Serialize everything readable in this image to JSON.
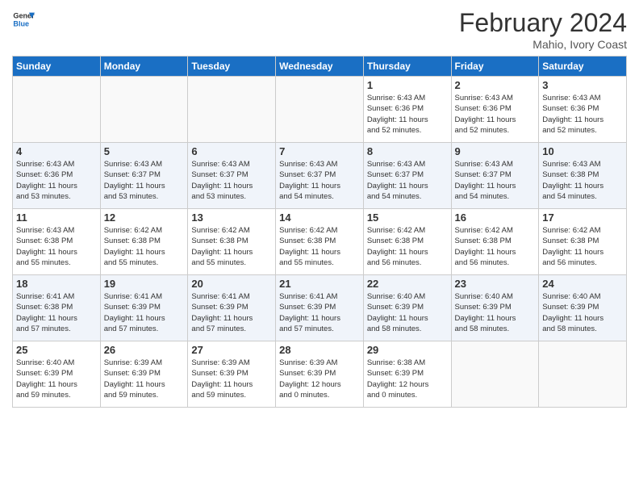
{
  "header": {
    "logo_line1": "General",
    "logo_line2": "Blue",
    "month": "February 2024",
    "location": "Mahio, Ivory Coast"
  },
  "days_of_week": [
    "Sunday",
    "Monday",
    "Tuesday",
    "Wednesday",
    "Thursday",
    "Friday",
    "Saturday"
  ],
  "weeks": [
    [
      {
        "day": "",
        "info": ""
      },
      {
        "day": "",
        "info": ""
      },
      {
        "day": "",
        "info": ""
      },
      {
        "day": "",
        "info": ""
      },
      {
        "day": "1",
        "info": "Sunrise: 6:43 AM\nSunset: 6:36 PM\nDaylight: 11 hours\nand 52 minutes."
      },
      {
        "day": "2",
        "info": "Sunrise: 6:43 AM\nSunset: 6:36 PM\nDaylight: 11 hours\nand 52 minutes."
      },
      {
        "day": "3",
        "info": "Sunrise: 6:43 AM\nSunset: 6:36 PM\nDaylight: 11 hours\nand 52 minutes."
      }
    ],
    [
      {
        "day": "4",
        "info": "Sunrise: 6:43 AM\nSunset: 6:36 PM\nDaylight: 11 hours\nand 53 minutes."
      },
      {
        "day": "5",
        "info": "Sunrise: 6:43 AM\nSunset: 6:37 PM\nDaylight: 11 hours\nand 53 minutes."
      },
      {
        "day": "6",
        "info": "Sunrise: 6:43 AM\nSunset: 6:37 PM\nDaylight: 11 hours\nand 53 minutes."
      },
      {
        "day": "7",
        "info": "Sunrise: 6:43 AM\nSunset: 6:37 PM\nDaylight: 11 hours\nand 54 minutes."
      },
      {
        "day": "8",
        "info": "Sunrise: 6:43 AM\nSunset: 6:37 PM\nDaylight: 11 hours\nand 54 minutes."
      },
      {
        "day": "9",
        "info": "Sunrise: 6:43 AM\nSunset: 6:37 PM\nDaylight: 11 hours\nand 54 minutes."
      },
      {
        "day": "10",
        "info": "Sunrise: 6:43 AM\nSunset: 6:38 PM\nDaylight: 11 hours\nand 54 minutes."
      }
    ],
    [
      {
        "day": "11",
        "info": "Sunrise: 6:43 AM\nSunset: 6:38 PM\nDaylight: 11 hours\nand 55 minutes."
      },
      {
        "day": "12",
        "info": "Sunrise: 6:42 AM\nSunset: 6:38 PM\nDaylight: 11 hours\nand 55 minutes."
      },
      {
        "day": "13",
        "info": "Sunrise: 6:42 AM\nSunset: 6:38 PM\nDaylight: 11 hours\nand 55 minutes."
      },
      {
        "day": "14",
        "info": "Sunrise: 6:42 AM\nSunset: 6:38 PM\nDaylight: 11 hours\nand 55 minutes."
      },
      {
        "day": "15",
        "info": "Sunrise: 6:42 AM\nSunset: 6:38 PM\nDaylight: 11 hours\nand 56 minutes."
      },
      {
        "day": "16",
        "info": "Sunrise: 6:42 AM\nSunset: 6:38 PM\nDaylight: 11 hours\nand 56 minutes."
      },
      {
        "day": "17",
        "info": "Sunrise: 6:42 AM\nSunset: 6:38 PM\nDaylight: 11 hours\nand 56 minutes."
      }
    ],
    [
      {
        "day": "18",
        "info": "Sunrise: 6:41 AM\nSunset: 6:38 PM\nDaylight: 11 hours\nand 57 minutes."
      },
      {
        "day": "19",
        "info": "Sunrise: 6:41 AM\nSunset: 6:39 PM\nDaylight: 11 hours\nand 57 minutes."
      },
      {
        "day": "20",
        "info": "Sunrise: 6:41 AM\nSunset: 6:39 PM\nDaylight: 11 hours\nand 57 minutes."
      },
      {
        "day": "21",
        "info": "Sunrise: 6:41 AM\nSunset: 6:39 PM\nDaylight: 11 hours\nand 57 minutes."
      },
      {
        "day": "22",
        "info": "Sunrise: 6:40 AM\nSunset: 6:39 PM\nDaylight: 11 hours\nand 58 minutes."
      },
      {
        "day": "23",
        "info": "Sunrise: 6:40 AM\nSunset: 6:39 PM\nDaylight: 11 hours\nand 58 minutes."
      },
      {
        "day": "24",
        "info": "Sunrise: 6:40 AM\nSunset: 6:39 PM\nDaylight: 11 hours\nand 58 minutes."
      }
    ],
    [
      {
        "day": "25",
        "info": "Sunrise: 6:40 AM\nSunset: 6:39 PM\nDaylight: 11 hours\nand 59 minutes."
      },
      {
        "day": "26",
        "info": "Sunrise: 6:39 AM\nSunset: 6:39 PM\nDaylight: 11 hours\nand 59 minutes."
      },
      {
        "day": "27",
        "info": "Sunrise: 6:39 AM\nSunset: 6:39 PM\nDaylight: 11 hours\nand 59 minutes."
      },
      {
        "day": "28",
        "info": "Sunrise: 6:39 AM\nSunset: 6:39 PM\nDaylight: 12 hours\nand 0 minutes."
      },
      {
        "day": "29",
        "info": "Sunrise: 6:38 AM\nSunset: 6:39 PM\nDaylight: 12 hours\nand 0 minutes."
      },
      {
        "day": "",
        "info": ""
      },
      {
        "day": "",
        "info": ""
      }
    ]
  ]
}
